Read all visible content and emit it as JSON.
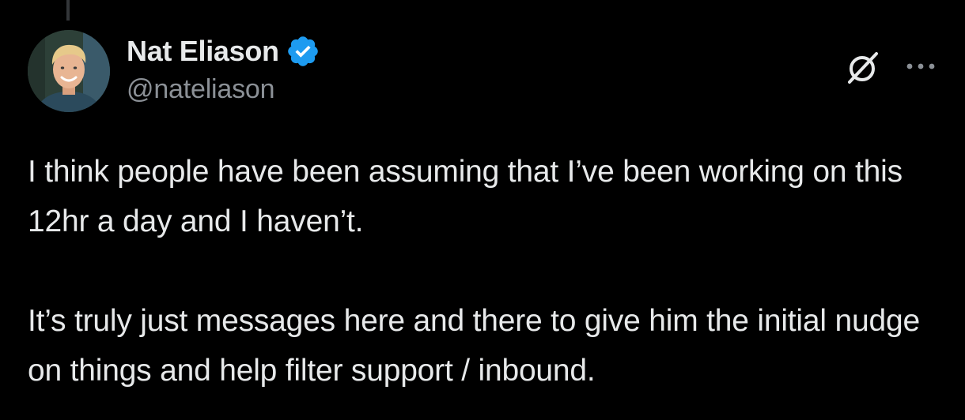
{
  "author": {
    "display_name": "Nat Eliason",
    "handle": "@nateliason",
    "verified": true
  },
  "tweet": {
    "paragraphs": [
      "I think people have been assuming that I’ve been working on this 12hr a day and I haven’t.",
      "It’s truly just messages here and there to give him the initial nudge on things and help filter support / inbound."
    ]
  },
  "icons": {
    "verified_badge": "verified-badge-icon",
    "grok": "grok-icon",
    "more": "more-icon"
  },
  "colors": {
    "background": "#000000",
    "text": "#e7e9ea",
    "secondary_text": "#8b9096",
    "verified_blue": "#1d9bf0"
  }
}
